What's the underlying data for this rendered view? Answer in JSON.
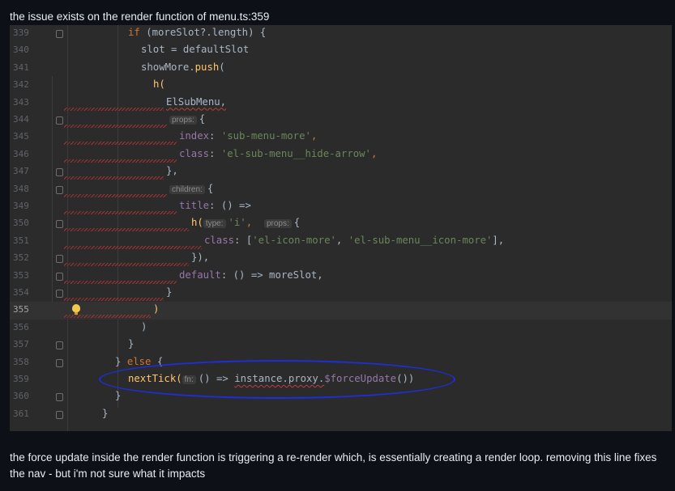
{
  "intro_text": "the issue exists on the render function of menu.ts:359",
  "outro_text": "the force update inside the render function is triggering a re-render which, is essentially creating a render loop. removing this line fixes the nav - but i'm not sure what it impacts",
  "editor": {
    "current_line": "355",
    "lines": [
      {
        "num": "339"
      },
      {
        "num": "340"
      },
      {
        "num": "341"
      },
      {
        "num": "342"
      },
      {
        "num": "343"
      },
      {
        "num": "344"
      },
      {
        "num": "345"
      },
      {
        "num": "346"
      },
      {
        "num": "347"
      },
      {
        "num": "348"
      },
      {
        "num": "349"
      },
      {
        "num": "350"
      },
      {
        "num": "351"
      },
      {
        "num": "352"
      },
      {
        "num": "353"
      },
      {
        "num": "354"
      },
      {
        "num": "355"
      },
      {
        "num": "356"
      },
      {
        "num": "357"
      },
      {
        "num": "358"
      },
      {
        "num": "359"
      },
      {
        "num": "360"
      },
      {
        "num": "361"
      }
    ],
    "code": {
      "l339_kw": "if",
      "l339_rest": " (moreSlot?.length) {",
      "l339_prop": "length",
      "l340": "slot = defaultSlot",
      "l341_a": "showMore.",
      "l341_fn": "push",
      "l341_b": "(",
      "l342": "h(",
      "l343": "ElSubMenu,",
      "l344_hint": "props:",
      "l344": "{",
      "l345_key": "index",
      "l345_val": "'sub-menu-more'",
      "l345_end": ",",
      "l346_key": "class",
      "l346_val": "'el-sub-menu__hide-arrow'",
      "l346_end": ",",
      "l347": "},",
      "l348_hint": "children:",
      "l348": "{",
      "l349_key": "title",
      "l349_rest": ": () =>",
      "l350_a": "h(",
      "l350_hint1": "type:",
      "l350_str": "'i'",
      "l350_comma": ",",
      "l350_hint2": "props:",
      "l350_end": "{",
      "l351_key": "class",
      "l351_a": ": [",
      "l351_s1": "'el-icon-more'",
      "l351_c": ", ",
      "l351_s2": "'el-sub-menu__icon-more'",
      "l351_end": "],",
      "l352": "}),",
      "l353_key": "default",
      "l353_rest": ": () => moreSlot,",
      "l354": "}",
      "l355": ")",
      "l356": ")",
      "l357": "}",
      "l358_a": "} ",
      "l358_kw": "else",
      "l358_b": " {",
      "l359_fn": "nextTick(",
      "l359_hint": "fn:",
      "l359_a": "() => ",
      "l359_b": "instance.proxy.",
      "l359_prop": "$forceUpdate",
      "l359_end": "())",
      "l360": "}",
      "l361": "}"
    }
  }
}
